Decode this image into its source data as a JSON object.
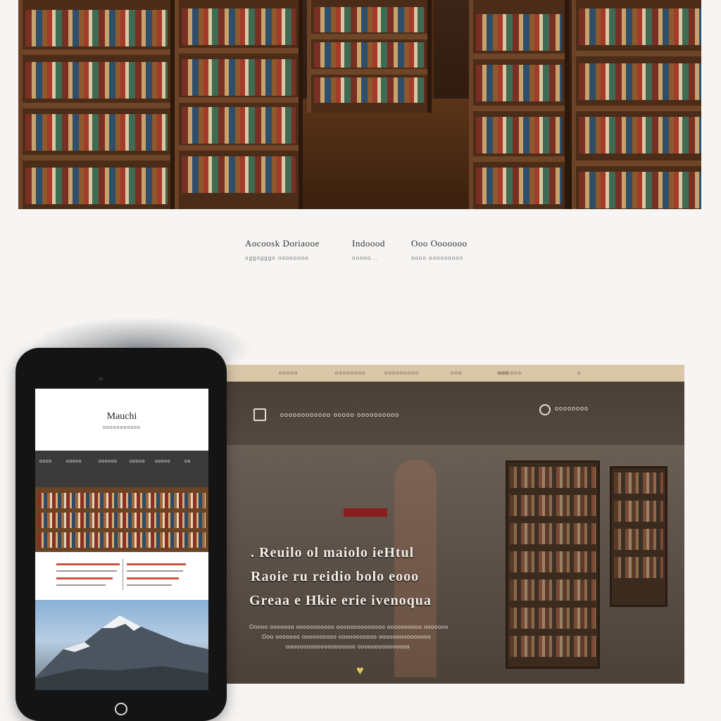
{
  "banner": {
    "alt_icon": "bookshelf-photo"
  },
  "caption": {
    "items": [
      {
        "title": "Aocoosk Doriaooe",
        "sub": "oggogggo oooooooo"
      },
      {
        "title": "Indoood",
        "sub": "ooooo..."
      },
      {
        "title": "Ooo Ooooooo",
        "sub": "oooo ooooooooo"
      }
    ]
  },
  "website": {
    "nav": [
      "ooooo",
      "oooooooo",
      "ooooooooo",
      "ooo",
      "ooo",
      "oooooo",
      "o"
    ],
    "topbar": {
      "icon": "book-icon",
      "text": "oooooooooooo ooooo oooooooooo",
      "right_icon": "search-icon",
      "right_text": "oooooooo"
    },
    "hero": {
      "line1": ". Reuilo ol maiolo ieHtul",
      "line2": "Raoie ru reidio bolo eooo",
      "line3": "Greaa e Hkie erie ivenoqua",
      "small1": "Ooooo ooooooo ooooooooooo oooooooooooooo oooooooooo ooooooo",
      "small2": "Ooo ooooooo oooooooooo ooooooooooo ooooooooooooooo",
      "small3": "oooooooooooooooooooo ooooooooooooooo",
      "heart_icon": "heart-icon"
    }
  },
  "phone": {
    "header_title": "Mauchi",
    "header_sub": "ooooooooooo",
    "nav": [
      "oooo",
      "ooooo",
      "oooooo",
      "ooooo",
      "ooooo",
      "oo"
    ],
    "home_icon": "home-button-icon"
  },
  "colors": {
    "accent": "#c9573f",
    "nav": "#d9c7a8",
    "phone": "#141414"
  }
}
